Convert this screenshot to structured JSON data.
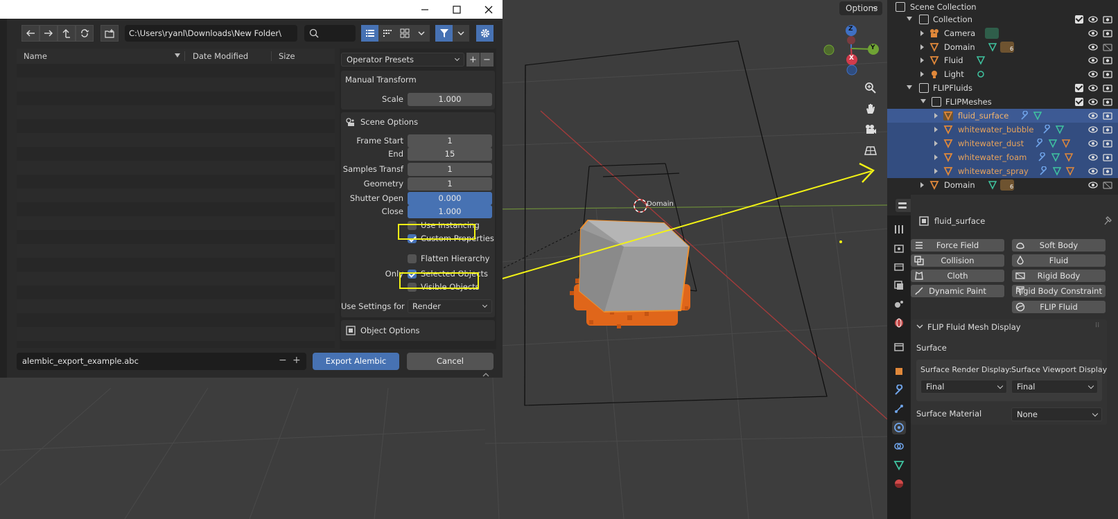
{
  "viewport": {
    "options_label": "Options",
    "domain_label": "Domain",
    "gizmo_axes": [
      "Z",
      "Y",
      "X"
    ]
  },
  "dialog": {
    "window_buttons": [
      "minimize",
      "maximize",
      "close"
    ],
    "path": "C:\\Users\\ryanl\\Downloads\\New Folder\\",
    "columns": [
      "Name",
      "Date Modified",
      "Size"
    ],
    "operator_presets": "Operator Presets",
    "manual_transform": {
      "title": "Manual Transform",
      "scale_label": "Scale",
      "scale_value": "1.000"
    },
    "scene_options": {
      "title": "Scene Options",
      "frame_start_label": "Frame Start",
      "frame_start": "1",
      "end_label": "End",
      "end": "15",
      "samples_label": "Samples Transf",
      "samples": "1",
      "geometry_label": "Geometry",
      "geometry": "1",
      "shutter_open_label": "Shutter Open",
      "shutter_open": "0.000",
      "close_label": "Close",
      "close": "1.000",
      "use_instancing": "Use Instancing",
      "custom_properties": "Custom Properties",
      "flatten_hierarchy": "Flatten Hierarchy",
      "only_label": "Only",
      "selected_objects": "Selected Objects",
      "visible_objects": "Visible Objects",
      "use_settings_label": "Use Settings for",
      "use_settings_value": "Render"
    },
    "object_options": "Object Options",
    "filename": "alembic_export_example.abc",
    "export_label": "Export Alembic",
    "cancel_label": "Cancel"
  },
  "outliner": {
    "rows": [
      {
        "name": "Scene Collection"
      },
      {
        "name": "Collection"
      },
      {
        "name": "Camera"
      },
      {
        "name": "Domain",
        "badge": "6"
      },
      {
        "name": "Fluid"
      },
      {
        "name": "Light"
      },
      {
        "name": "FLIPFluids"
      },
      {
        "name": "FLIPMeshes"
      },
      {
        "name": "fluid_surface"
      },
      {
        "name": "whitewater_bubble"
      },
      {
        "name": "whitewater_dust"
      },
      {
        "name": "whitewater_foam"
      },
      {
        "name": "whitewater_spray"
      },
      {
        "name": "Domain",
        "badge": "6"
      }
    ]
  },
  "properties": {
    "object_name": "fluid_surface",
    "physics_buttons": [
      "Force Field",
      "Soft Body",
      "Collision",
      "Fluid",
      "Cloth",
      "Rigid Body",
      "Dynamic Paint",
      "Rigid Body Constraint",
      "FLIP Fluid"
    ],
    "panel_title": "FLIP Fluid Mesh Display",
    "surface_label": "Surface",
    "render_display_label": "Surface Render Display:",
    "viewport_display_label": "Surface Viewport Display",
    "render_display_value": "Final",
    "viewport_display_value": "Final",
    "material_label": "Surface Material",
    "material_value": "None"
  },
  "colors": {
    "accent": "#4772b3",
    "highlight": "#f2f215",
    "selected_object": "#e8a35b",
    "outline": "#ee8f2e"
  }
}
